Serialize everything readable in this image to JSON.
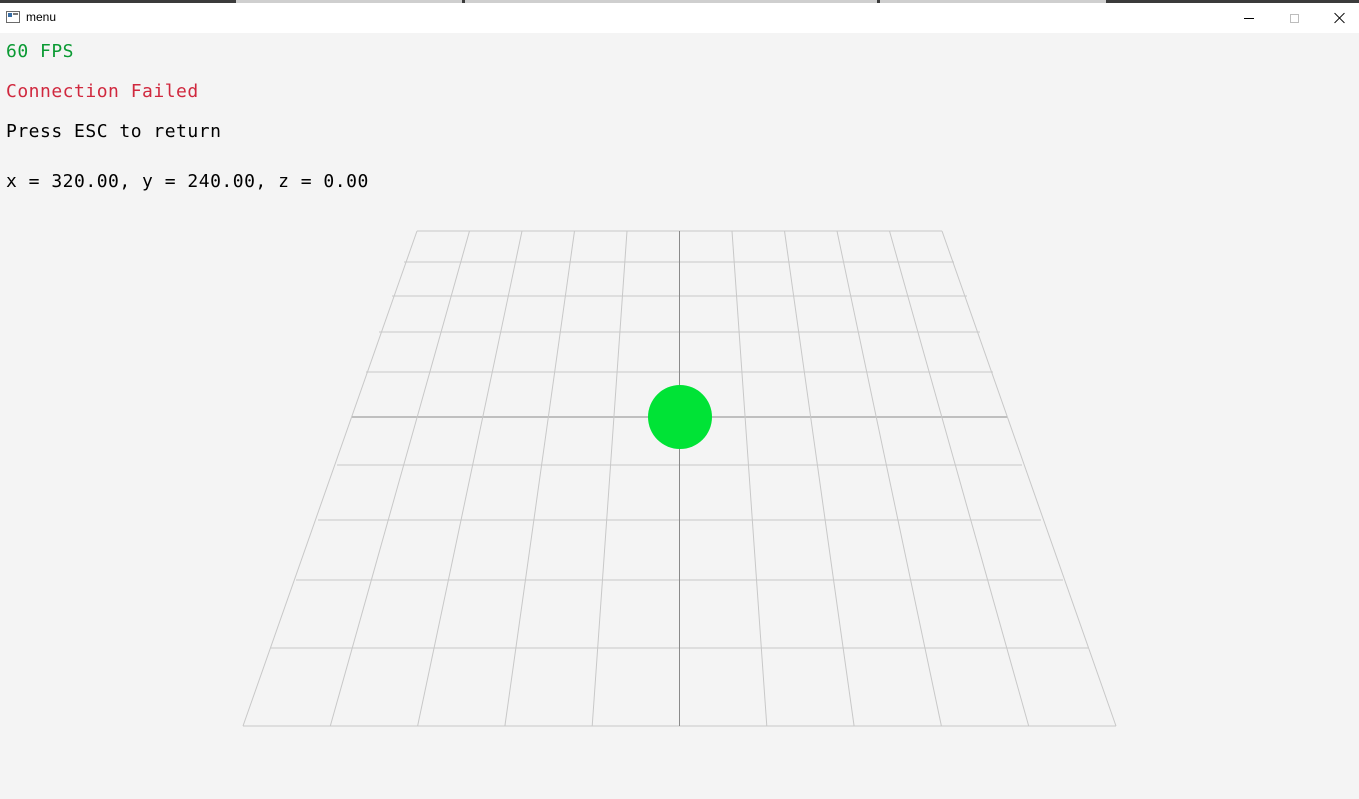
{
  "window": {
    "title": "menu",
    "minimize_label": "",
    "maximize_label": "",
    "close_label": ""
  },
  "hud": {
    "fps_text": "60 FPS",
    "connection_text": "Connection Failed",
    "hint_text": "Press ESC to return",
    "coords_text": "x = 320.00, y = 240.00, z = 0.00"
  },
  "colors": {
    "fps": "#0a9a33",
    "connection": "#d0283e",
    "ball": "#00e336",
    "grid_line": "#c8c8c8",
    "axis_line": "#8a8a8a",
    "background": "#f4f4f4"
  },
  "icons": {
    "app": "app-window-icon",
    "minimize": "minimize-icon",
    "maximize": "maximize-icon",
    "close": "close-icon"
  }
}
